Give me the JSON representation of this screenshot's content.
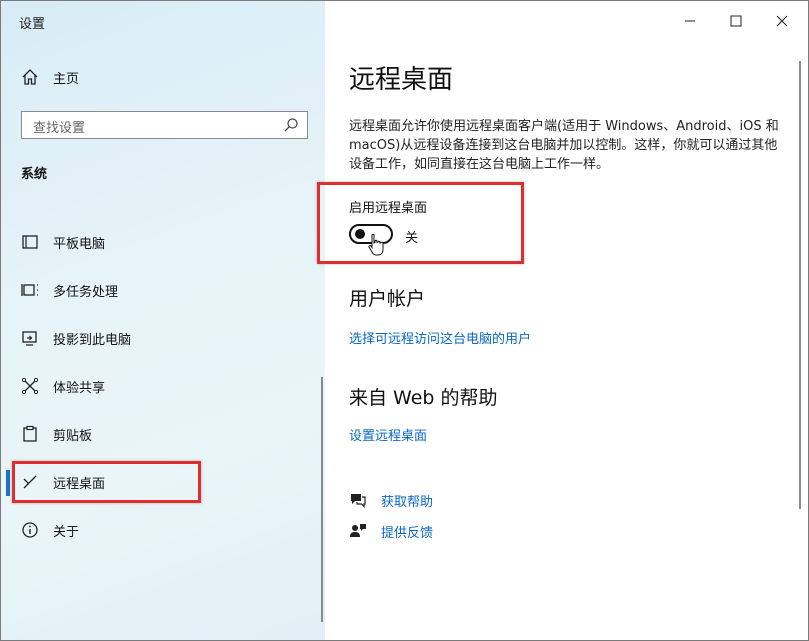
{
  "window": {
    "title": "设置"
  },
  "sidebar": {
    "home_label": "主页",
    "search_placeholder": "查找设置",
    "section_title": "系统",
    "items": [
      {
        "label": "平板电脑",
        "icon": "tablet-icon"
      },
      {
        "label": "多任务处理",
        "icon": "multitask-icon"
      },
      {
        "label": "投影到此电脑",
        "icon": "project-icon"
      },
      {
        "label": "体验共享",
        "icon": "share-experience-icon"
      },
      {
        "label": "剪贴板",
        "icon": "clipboard-icon"
      },
      {
        "label": "远程桌面",
        "icon": "remote-desktop-icon",
        "active": true
      },
      {
        "label": "关于",
        "icon": "info-icon"
      }
    ]
  },
  "main": {
    "title": "远程桌面",
    "description": "远程桌面允许你使用远程桌面客户端(适用于 Windows、Android、iOS 和 macOS)从远程设备连接到这台电脑并加以控制。这样，你就可以通过其他设备工作，如同直接在这台电脑上工作一样。",
    "toggle": {
      "label": "启用远程桌面",
      "state_label": "关",
      "on": false
    },
    "user_accounts": {
      "heading": "用户帐户",
      "link": "选择可远程访问这台电脑的用户"
    },
    "web_help": {
      "heading": "来自 Web 的帮助",
      "link": "设置远程桌面"
    },
    "help_links": [
      {
        "label": "获取帮助",
        "icon": "help-chat-icon"
      },
      {
        "label": "提供反馈",
        "icon": "feedback-icon"
      }
    ]
  },
  "colors": {
    "accent": "#1a73c9",
    "link": "#0a67c4",
    "highlight_box": "#e02d2d"
  }
}
